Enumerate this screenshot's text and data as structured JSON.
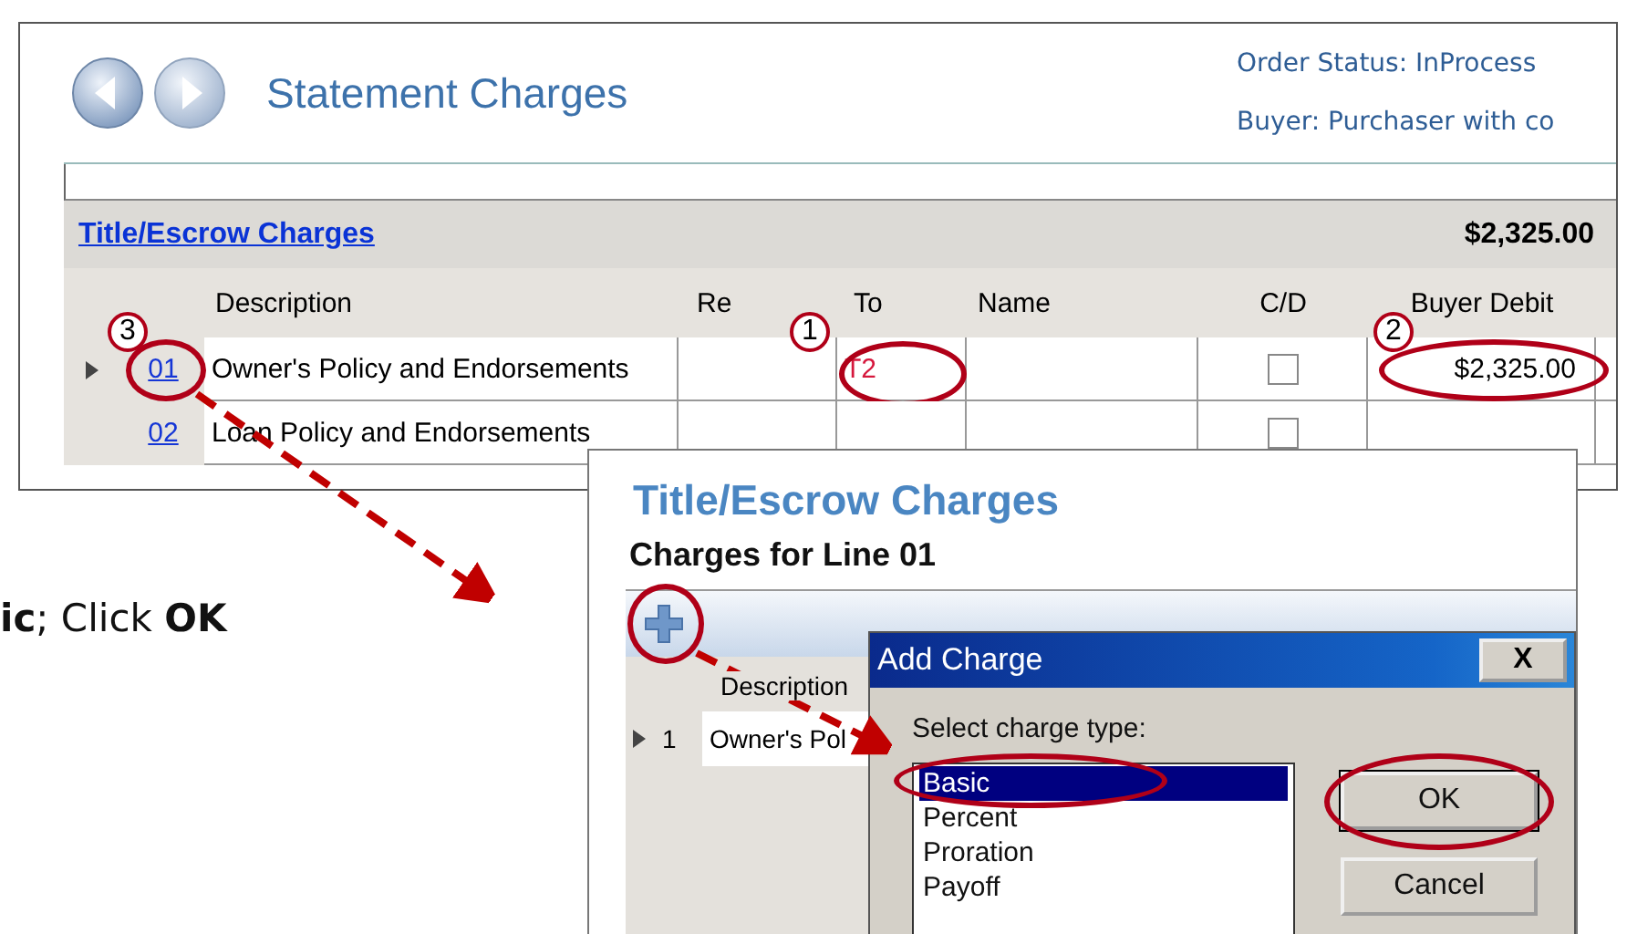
{
  "main_window": {
    "title": "Statement Charges",
    "order_status": "Order Status: InProcess",
    "buyer": "Buyer: Purchaser with co",
    "group": {
      "title": "Title/Escrow Charges",
      "total": "$2,325.00"
    },
    "columns": [
      "Description",
      "Re",
      "To",
      "Name",
      "C/D",
      "Buyer Debit"
    ],
    "rows": [
      {
        "current": true,
        "line": "01",
        "description": "Owner's Policy and Endorsements",
        "to": "T2",
        "cd_checked": false,
        "buyer_debit": "$2,325.00",
        "line_circled": true,
        "to_circled": true,
        "debit_circled": true,
        "line_callout": "3",
        "to_callout": "1",
        "debit_callout": "2"
      },
      {
        "current": false,
        "line": "02",
        "description": "Loan Policy and Endorsements",
        "to": "",
        "cd_checked": false,
        "buyer_debit": "",
        "line_circled": false,
        "to_circled": false,
        "debit_circled": false
      }
    ]
  },
  "instruction": "**ic**; Click **OK**",
  "charges_window": {
    "title": "Title/Escrow Charges",
    "subtitle": "Charges for Line 01",
    "add_circled": true,
    "grid_column": "Description",
    "grid_rows": [
      {
        "current": true,
        "number": "1",
        "description": "Owner's Pol"
      }
    ]
  },
  "add_charge_dialog": {
    "title": "Add Charge",
    "close": "X",
    "prompt": "Select charge type:",
    "charge_types": [
      {
        "label": "Basic",
        "selected": true,
        "circled": true
      },
      {
        "label": "Percent",
        "selected": false,
        "circled": false
      },
      {
        "label": "Proration",
        "selected": false,
        "circled": false
      },
      {
        "label": "Payoff",
        "selected": false,
        "circled": false
      }
    ],
    "buttons": [
      {
        "label": "OK",
        "circled": true,
        "default": true
      },
      {
        "label": "Cancel",
        "circled": false,
        "default": false
      }
    ]
  }
}
